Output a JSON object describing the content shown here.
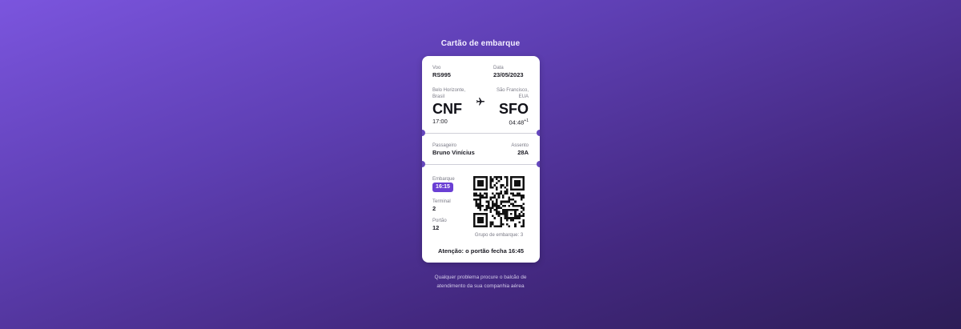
{
  "page_title": "Cartão de embarque",
  "flight": {
    "label": "Voo",
    "value": "RS995"
  },
  "date": {
    "label": "Data",
    "value": "23/05/2023"
  },
  "origin": {
    "city_line1": "Belo Horizonte,",
    "city_line2": "Brasil",
    "code": "CNF",
    "time": "17:00"
  },
  "destination": {
    "city_line1": "São Francisco,",
    "city_line2": "EUA",
    "code": "SFO",
    "time": "04:48",
    "time_suffix": "+1"
  },
  "passenger": {
    "label": "Passageiro",
    "value": "Bruno Vinícius"
  },
  "seat": {
    "label": "Assento",
    "value": "28A"
  },
  "boarding": {
    "label": "Embarque",
    "value": "16:15"
  },
  "terminal": {
    "label": "Terminal",
    "value": "2"
  },
  "gate": {
    "label": "Portão",
    "value": "12"
  },
  "group": "Grupo de embarque: 3",
  "warning": "Atenção: o portão fecha 16:45",
  "footer": {
    "line1": "Qualquer problema procure o balcão de",
    "line2": "atendimento da sua companhia aérea"
  },
  "colors": {
    "badge": "#6a3fd4",
    "accent": "#6547bd"
  },
  "icons": {
    "route": "airplane-icon",
    "qr": "qr-code"
  }
}
